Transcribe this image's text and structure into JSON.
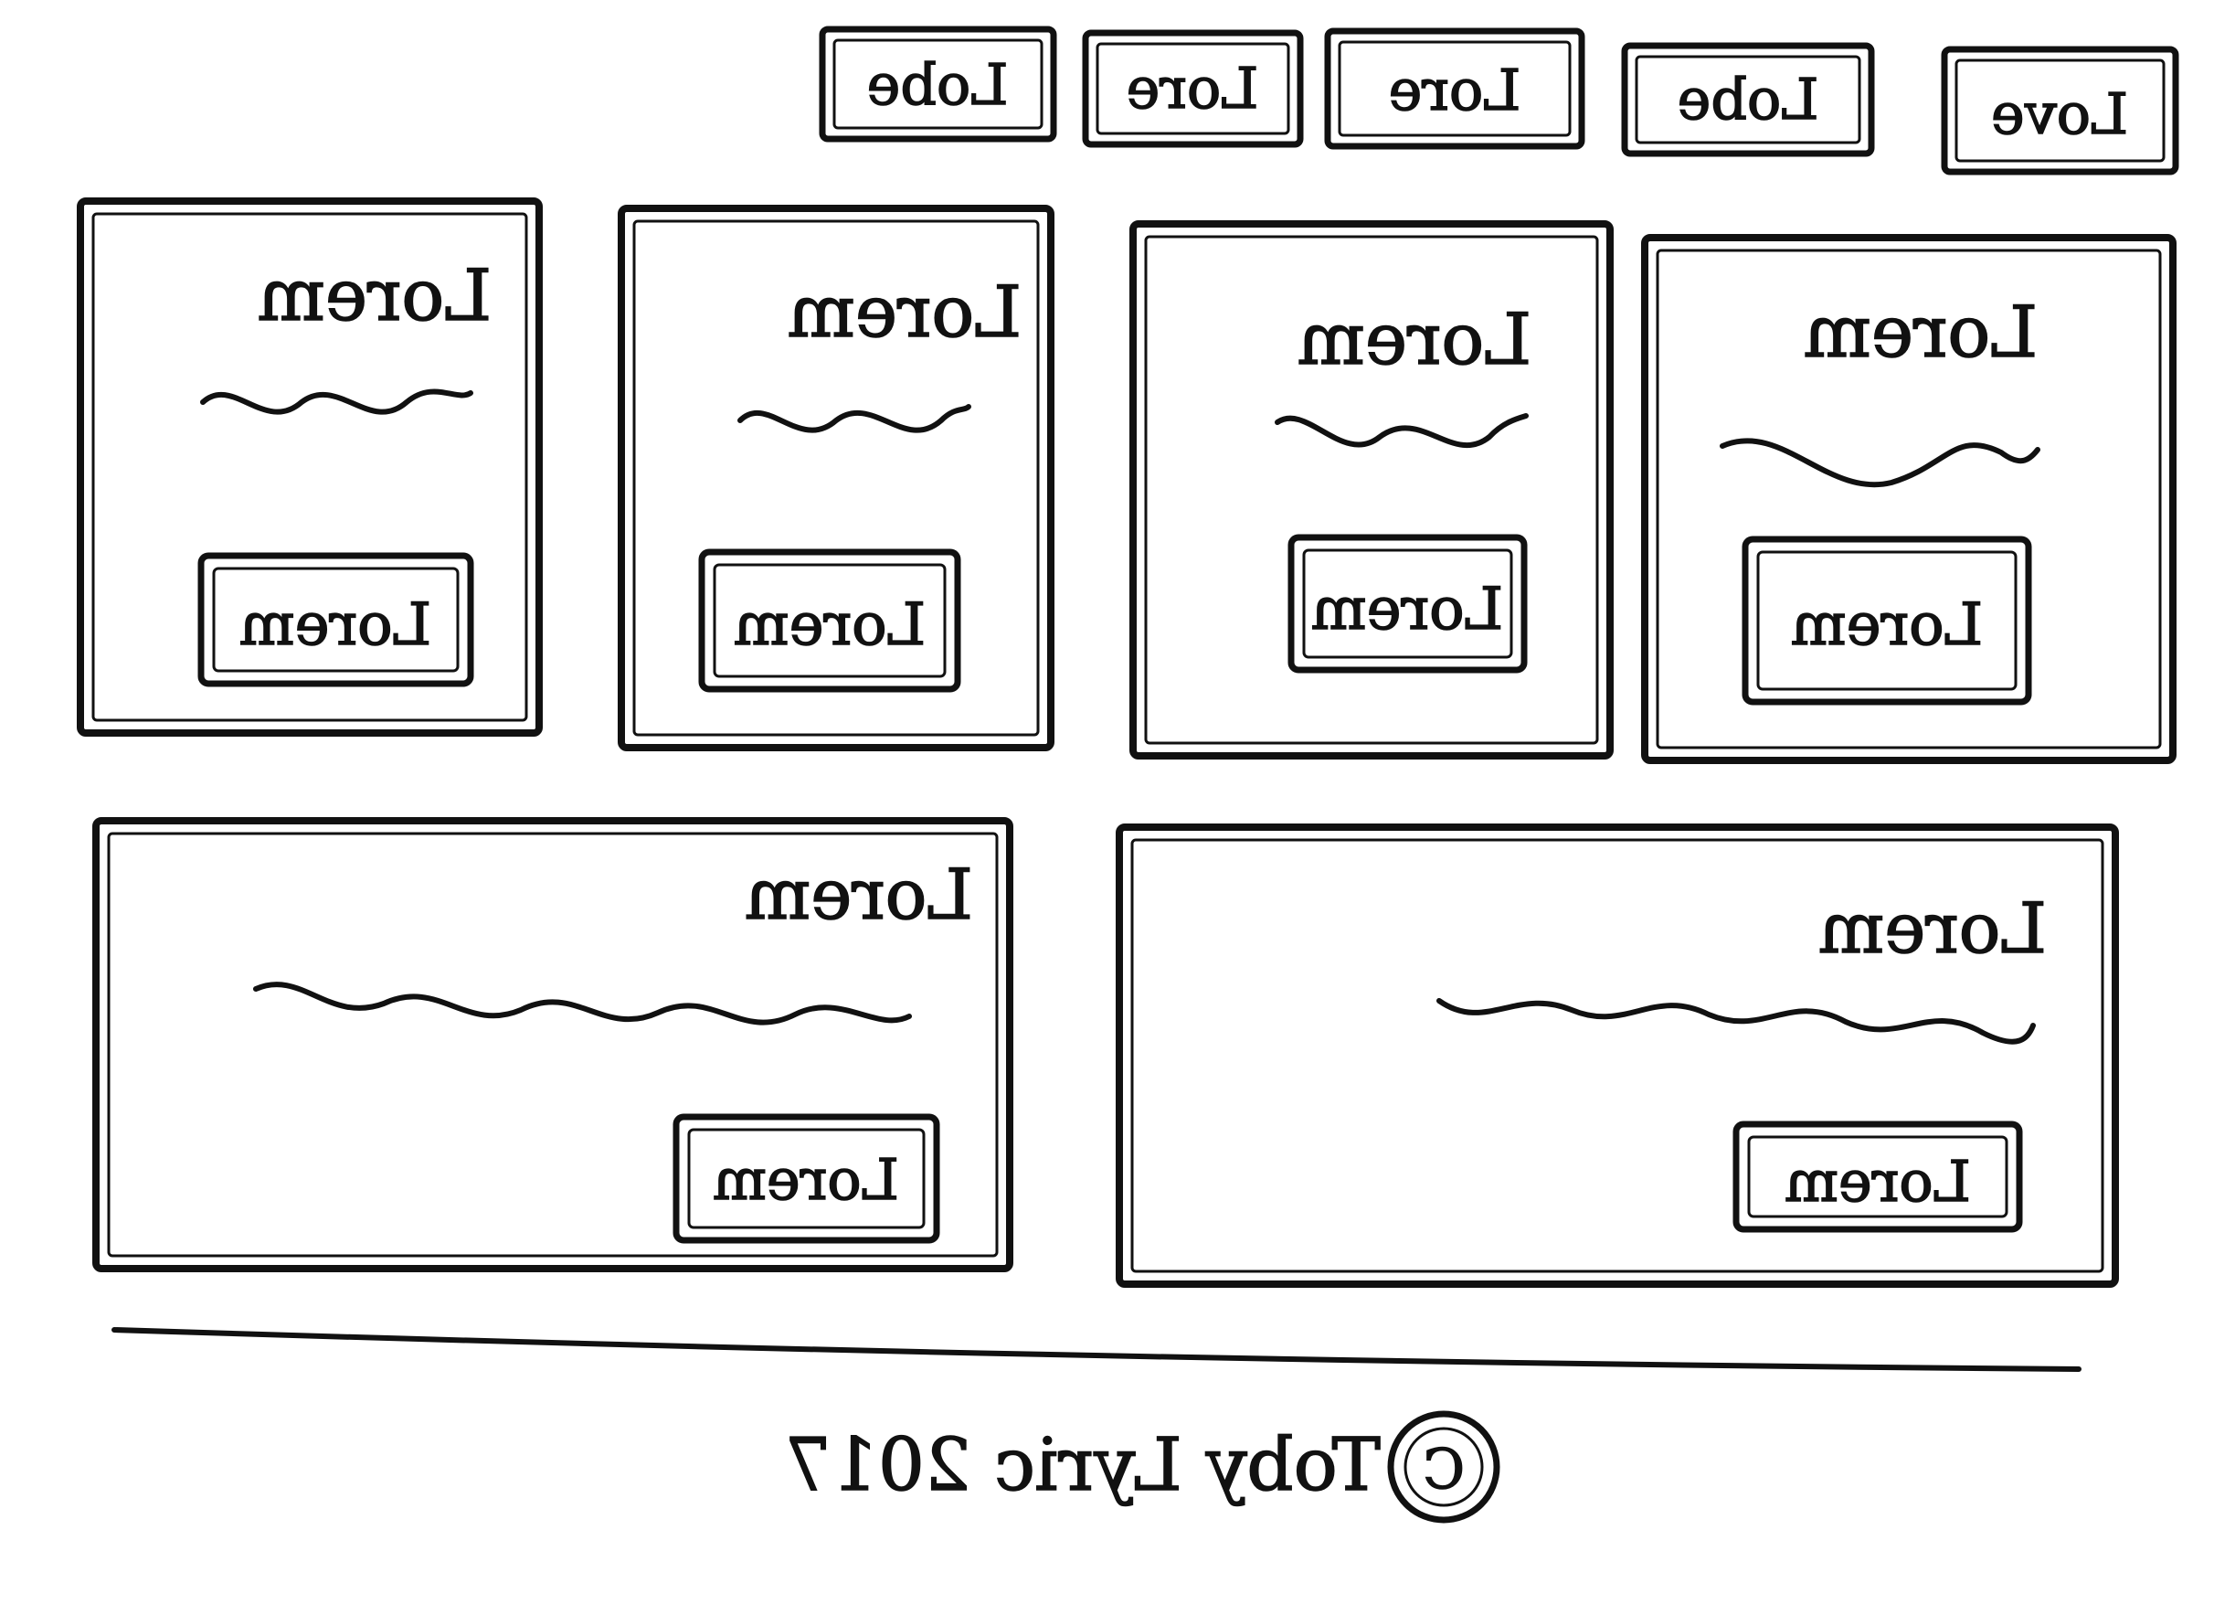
{
  "nav": {
    "items": [
      {
        "label": "Lobe"
      },
      {
        "label": "Lore"
      },
      {
        "label": "Lore"
      },
      {
        "label": "Lobe"
      },
      {
        "label": "Love"
      }
    ]
  },
  "cards_top": [
    {
      "title": "Lorem",
      "button": "Lorem"
    },
    {
      "title": "Lorem",
      "button": "Lorem"
    },
    {
      "title": "Lorem",
      "button": "Lorem"
    },
    {
      "title": "Lorem",
      "button": "Lorem"
    }
  ],
  "cards_wide": [
    {
      "title": "Lorem",
      "button": "Lorem"
    },
    {
      "title": "Lorem",
      "button": "Lorem"
    }
  ],
  "footer": {
    "copyright_symbol": "C",
    "text": "Toby Lyric 2017"
  },
  "colors": {
    "ink": "#111111",
    "paper": "#ffffff"
  }
}
